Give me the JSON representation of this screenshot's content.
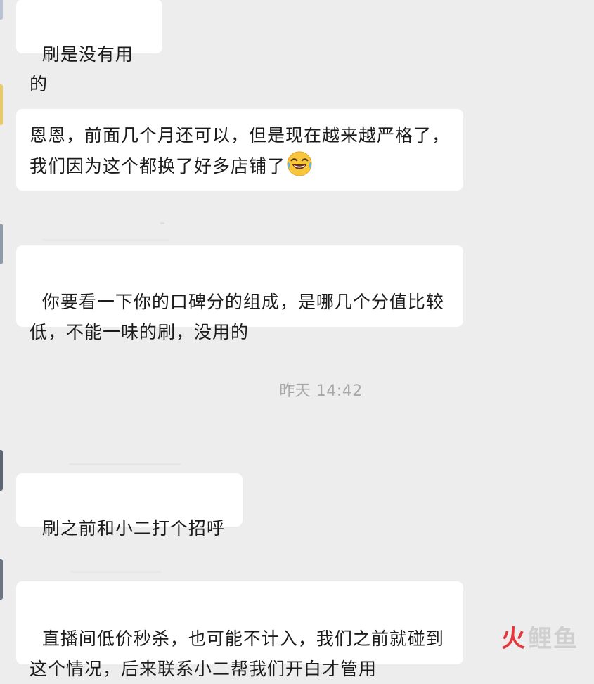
{
  "chat": {
    "messages": [
      {
        "text": "刷是没有用的"
      },
      {
        "text": "恩恩，前面几个月还可以，但是现在越来越严格了，我们因为这个都换了好多店铺了",
        "emoji": "laughing-crying-emoji"
      },
      {
        "text": "你要看一下你的口碑分的组成，是哪几个分值比较低，不能一味的刷，没用的"
      },
      {
        "text": "刷之前和小二打个招呼"
      },
      {
        "text": "直播间低价秒杀，也可能不计入，我们之前就碰到这个情况，后来联系小二帮我们开白才管用"
      }
    ],
    "timestamp": "昨天 14:42"
  },
  "watermark": {
    "part1": "火",
    "part2": "鲤鱼"
  },
  "colors": {
    "background": "#ededed",
    "bubble": "#ffffff",
    "text": "#1b1b1b",
    "timestamp": "#a8a8a8",
    "watermark_red": "#e4393c"
  }
}
